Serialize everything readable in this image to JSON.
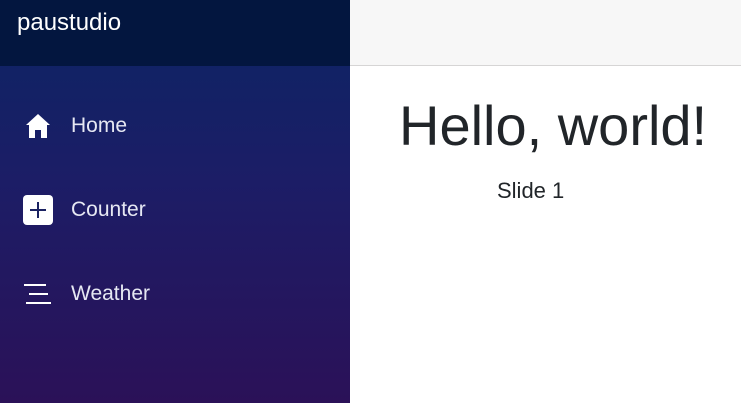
{
  "brand": {
    "title": "paustudio"
  },
  "sidebar": {
    "items": [
      {
        "label": "Home",
        "icon": "home-icon"
      },
      {
        "label": "Counter",
        "icon": "plus-square-icon"
      },
      {
        "label": "Weather",
        "icon": "list-lines-icon"
      }
    ]
  },
  "main": {
    "heading": "Hello, world!",
    "slide_text": "Slide 1"
  },
  "colors": {
    "sidebar_top": "#0b2564",
    "sidebar_bottom": "#2b1158",
    "brand_bar": "#03163f",
    "topbar": "#f7f7f7",
    "text_dark": "#212529",
    "nav_text": "#e6e8f3"
  }
}
